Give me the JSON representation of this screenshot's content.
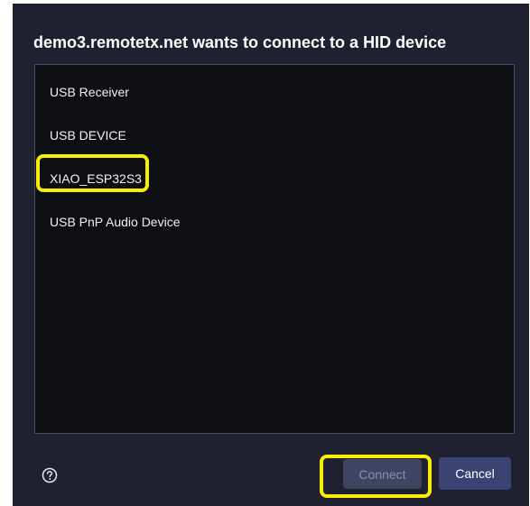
{
  "dialog": {
    "title": "demo3.remotetx.net wants to connect to a HID device",
    "devices": [
      {
        "label": "USB Receiver"
      },
      {
        "label": "USB DEVICE"
      },
      {
        "label": "XIAO_ESP32S3"
      },
      {
        "label": "USB PnP Audio Device"
      }
    ],
    "help_icon": "help-question-icon",
    "connect_label": "Connect",
    "cancel_label": "Cancel"
  },
  "colors": {
    "dialog_background": "#1f2131",
    "list_background": "#0d0f15",
    "highlight": "#f7ef00",
    "connect_disabled": "#3e4461",
    "cancel_button": "#3b4372"
  },
  "state": {
    "connect_enabled": false,
    "highlighted": [
      "XIAO_ESP32S3",
      "Connect"
    ]
  }
}
